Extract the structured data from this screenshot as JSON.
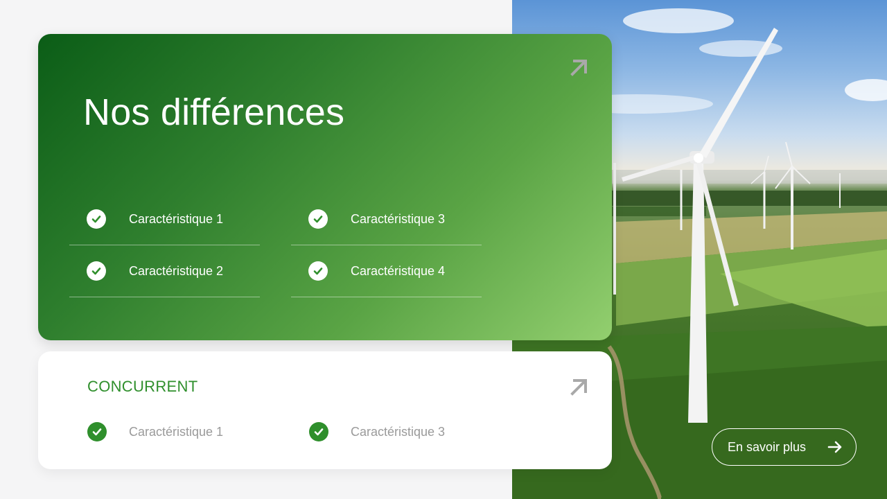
{
  "hero": {
    "title": "Nos différences",
    "features": [
      {
        "label": "Caractéristique 1"
      },
      {
        "label": "Caractéristique 3"
      },
      {
        "label": "Caractéristique 2"
      },
      {
        "label": "Caractéristique 4"
      }
    ]
  },
  "competitor": {
    "heading": "CONCURRENT",
    "features": [
      {
        "label": "Caractéristique 1"
      },
      {
        "label": "Caractéristique 3"
      }
    ]
  },
  "cta": {
    "label": "En savoir plus"
  },
  "icons": {
    "check": "check-icon",
    "corner": "arrow-up-right-icon",
    "cta": "arrow-right-icon"
  },
  "colors": {
    "accent_green": "#2f8f2c",
    "card_gradient_start": "#0b5d17",
    "card_gradient_end": "#93cf6f",
    "muted_text": "#9a9a9a"
  }
}
